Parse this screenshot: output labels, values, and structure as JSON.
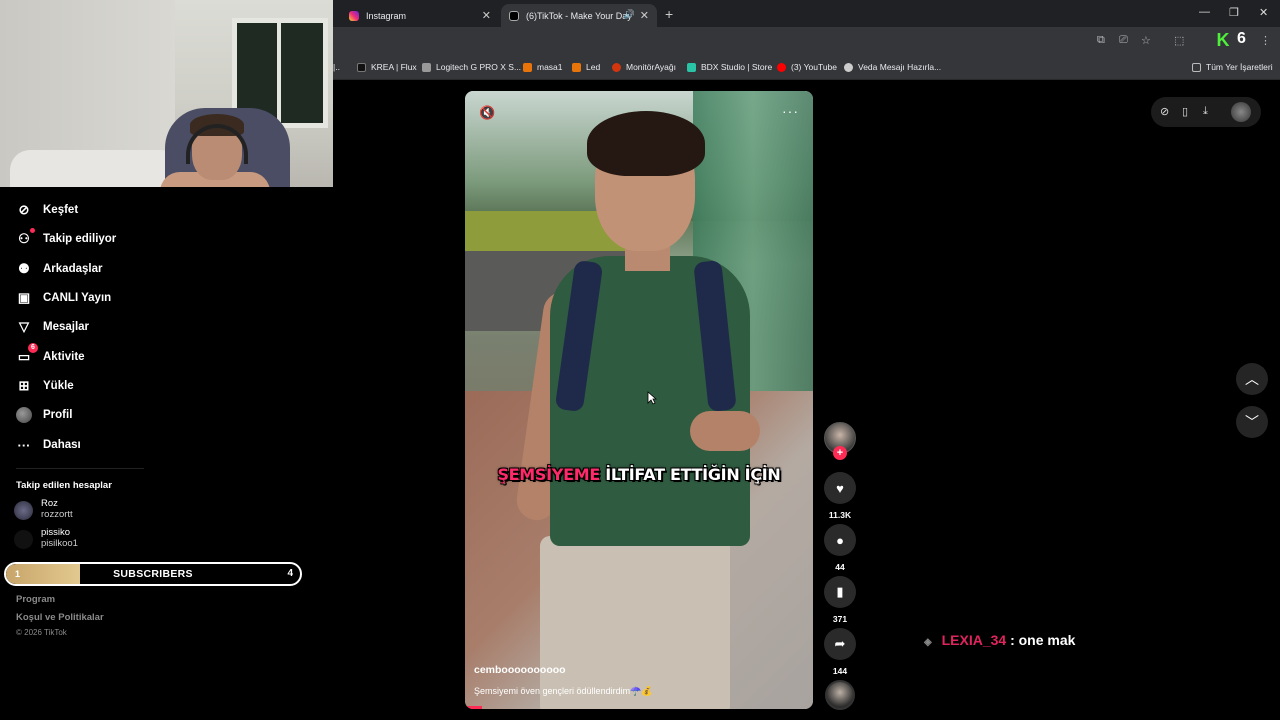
{
  "browser": {
    "tabs": [
      {
        "title": "Instagram",
        "active": false
      },
      {
        "title": "(6)TikTok - Make Your Day",
        "active": true
      }
    ],
    "extension_count": "6",
    "bookmarks": [
      "KREA | Flux",
      "Logitech G PRO X S...",
      "masa1",
      "Led",
      "MonitörAyağı",
      "BDX Studio | Store",
      "(3) YouTube",
      "Veda Mesajı Hazırla..."
    ],
    "bookmarks_all": "Tüm Yer İşaretleri"
  },
  "sidebar": {
    "nav": [
      {
        "label": "Keşfet",
        "icon": "compass-icon"
      },
      {
        "label": "Takip ediliyor",
        "icon": "user-follow-icon"
      },
      {
        "label": "Arkadaşlar",
        "icon": "friends-icon"
      },
      {
        "label": "CANLI Yayın",
        "icon": "live-tv-icon"
      },
      {
        "label": "Mesajlar",
        "icon": "send-icon"
      },
      {
        "label": "Aktivite",
        "icon": "activity-icon",
        "badge": "6"
      },
      {
        "label": "Yükle",
        "icon": "upload-plus-icon"
      },
      {
        "label": "Profil",
        "icon": "avatar-icon"
      },
      {
        "label": "Dahası",
        "icon": "more-dots-icon"
      }
    ],
    "following_title": "Takip edilen hesaplar",
    "accounts": [
      {
        "name": "Roz",
        "handle": "rozzortt"
      },
      {
        "name": "pissiko",
        "handle": "pisilkoo1"
      }
    ],
    "footer": {
      "program": "Program",
      "terms": "Koşul ve Politikalar",
      "copyright": "© 2026 TikTok"
    }
  },
  "subscribers_bar": {
    "label": "SUBSCRIBERS",
    "left": "1",
    "right": "4",
    "progress": 0.25
  },
  "video": {
    "caption_highlight": "ŞEMSİYEME",
    "caption_rest": "İLTİFAT ETTİĞİN İÇİN",
    "username": "cemboooooooooo",
    "description": "Şemsiyemi öven gençleri ödüllendirdim☂️💰",
    "progress": 0.05
  },
  "actions": {
    "likes": "11.3K",
    "comments": "44",
    "saves": "371",
    "shares": "144"
  },
  "chat": {
    "user": "LEXIA_34",
    "message": ": one mak"
  }
}
